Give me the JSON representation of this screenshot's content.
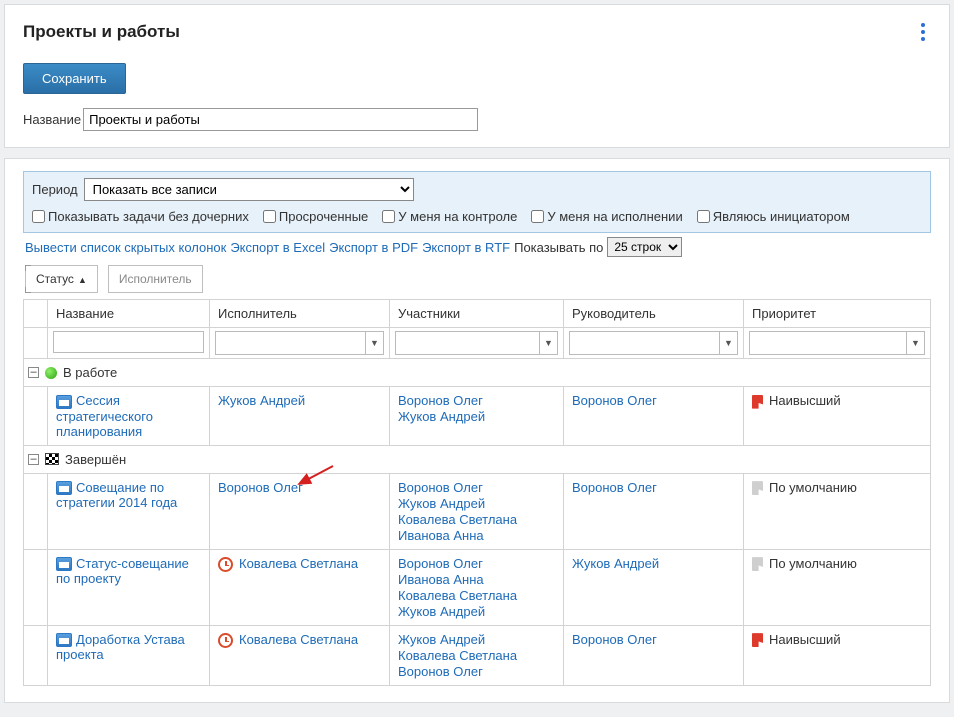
{
  "header": {
    "title": "Проекты и работы"
  },
  "save_label": "Сохранить",
  "name_label": "Название",
  "name_value": "Проекты и работы",
  "filter": {
    "period_label": "Период",
    "period_value": "Показать все записи",
    "checks": {
      "no_children": "Показывать задачи без дочерних",
      "overdue": "Просроченные",
      "my_control": "У меня на контроле",
      "my_exec": "У меня на исполнении",
      "initiator": "Являюсь инициатором"
    }
  },
  "actions": {
    "hidden_cols": "Вывести список скрытых колонок",
    "export_excel": "Экспорт в Excel",
    "export_pdf": "Экспорт в PDF",
    "export_rtf": "Экспорт в RTF",
    "show_per": "Показывать по",
    "per_value": "25 строк"
  },
  "groupers": {
    "status": "Статус",
    "executor_hint": "Исполнитель"
  },
  "columns": {
    "name": "Название",
    "executor": "Исполнитель",
    "participants": "Участники",
    "leader": "Руководитель",
    "priority": "Приоритет"
  },
  "groups": [
    {
      "status": "В работе",
      "status_kind": "green",
      "rows": [
        {
          "name": "Сессия стратегического планирования",
          "icon": "meeting",
          "exec_icon": "",
          "executor": "Жуков Андрей",
          "participants": [
            "Воронов Олег",
            "Жуков Андрей"
          ],
          "leader": "Воронов Олег",
          "priority": "Наивысший",
          "flag": "red"
        }
      ]
    },
    {
      "status": "Завершён",
      "status_kind": "finish",
      "rows": [
        {
          "name": "Совещание по стратегии 2014 года",
          "icon": "meeting",
          "exec_icon": "",
          "executor": "Воронов Олег",
          "participants": [
            "Воронов Олег",
            "Жуков Андрей",
            "Ковалева Светлана",
            "Иванова Анна"
          ],
          "leader": "Воронов Олег",
          "priority": "По умолчанию",
          "flag": "gray"
        },
        {
          "name": "Статус-совещание по проекту",
          "icon": "meeting",
          "exec_icon": "clock",
          "executor": "Ковалева Светлана",
          "participants": [
            "Воронов Олег",
            "Иванова Анна",
            "Ковалева Светлана",
            "Жуков Андрей"
          ],
          "leader": "Жуков Андрей",
          "priority": "По умолчанию",
          "flag": "gray"
        },
        {
          "name": "Доработка Устава проекта",
          "icon": "meeting",
          "exec_icon": "clock",
          "executor": "Ковалева Светлана",
          "participants": [
            "Жуков Андрей",
            "Ковалева Светлана",
            "Воронов Олег"
          ],
          "leader": "Воронов Олег",
          "priority": "Наивысший",
          "flag": "red"
        }
      ]
    }
  ]
}
